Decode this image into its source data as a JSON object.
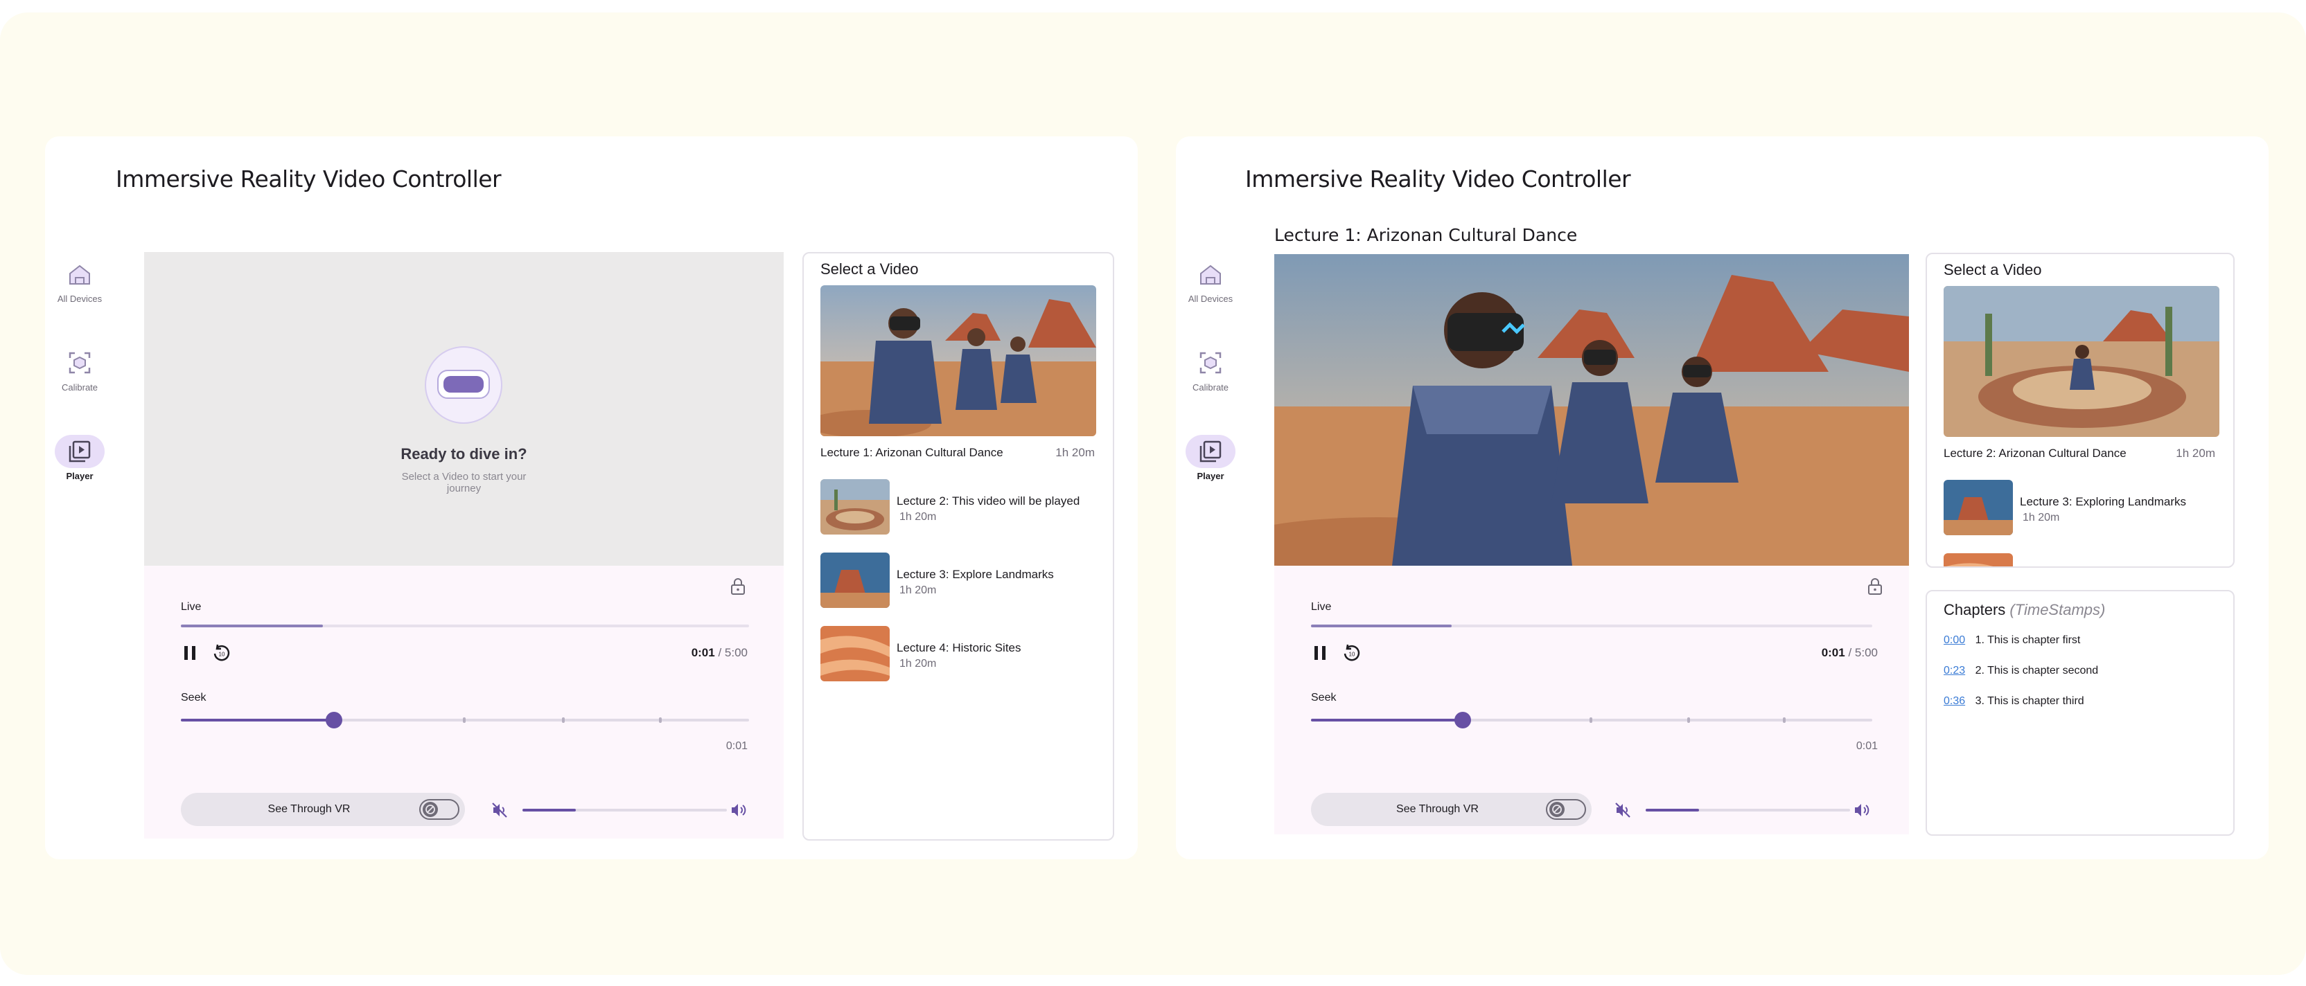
{
  "app_title": "Immersive Reality Video Controller",
  "nav": [
    {
      "label": "All Devices",
      "icon": "home-icon"
    },
    {
      "label": "Calibrate",
      "icon": "calibrate-icon"
    },
    {
      "label": "Player",
      "icon": "video-library-icon"
    }
  ],
  "empty_state": {
    "title": "Ready to dive in?",
    "subtitle": "Select a Video to start your journey"
  },
  "controls": {
    "live_label": "Live",
    "progress": 0.25,
    "current_time": "0:01",
    "total_time": "/ 5:00",
    "seek_label": "Seek",
    "seek_position": 0.27,
    "seek_time": "0:01",
    "see_through_label": "See Through VR",
    "volume": 0.26
  },
  "panel_a": {
    "list_title": "Select a Video",
    "featured": {
      "title": "Lecture 1: Arizonan Cultural Dance",
      "duration": "1h 20m"
    },
    "items": [
      {
        "title": "Lecture 2: This video will be played",
        "duration": "1h 20m"
      },
      {
        "title": "Lecture 3: Explore Landmarks",
        "duration": "1h 20m"
      },
      {
        "title": "Lecture 4: Historic Sites",
        "duration": "1h 20m"
      }
    ]
  },
  "panel_b": {
    "now_playing": "Lecture 1: Arizonan Cultural Dance",
    "list_title": "Select a Video",
    "featured": {
      "title": "Lecture 2: Arizonan Cultural Dance",
      "duration": "1h 20m"
    },
    "items": [
      {
        "title": "Lecture 3: Exploring Landmarks",
        "duration": "1h 20m"
      }
    ],
    "chapters_title": "Chapters",
    "chapters_subtitle": "(TimeStamps)",
    "chapters": [
      {
        "ts": "0:00",
        "label": "1. This is chapter first"
      },
      {
        "ts": "0:23",
        "label": "2. This is chapter second"
      },
      {
        "ts": "0:36",
        "label": "3. This is chapter third"
      }
    ]
  },
  "colors": {
    "accent": "#6750a4",
    "background": "#fefcf0",
    "player_bg": "#fdf6fc",
    "nav_active": "#e8def8"
  }
}
